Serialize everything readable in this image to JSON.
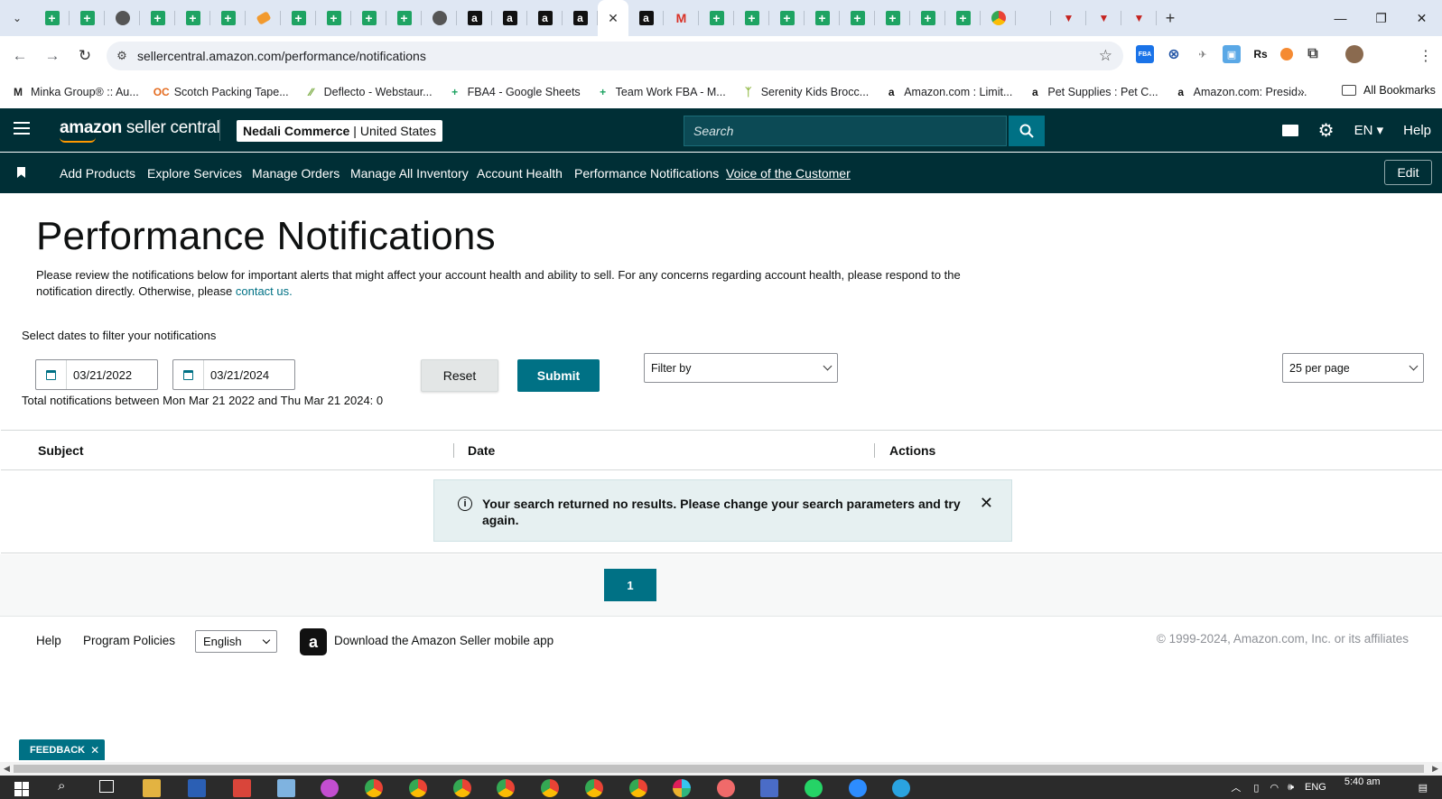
{
  "browser": {
    "tabs": [
      {
        "icon": "sheets-icon",
        "kind": "sheet"
      },
      {
        "icon": "sheets-icon",
        "kind": "sheet"
      },
      {
        "icon": "globe-icon",
        "kind": "circle"
      },
      {
        "icon": "sheets-icon",
        "kind": "sheet"
      },
      {
        "icon": "sheets-icon",
        "kind": "sheet"
      },
      {
        "icon": "sheets-icon",
        "kind": "sheet"
      },
      {
        "icon": "pen-icon",
        "kind": "pen"
      },
      {
        "icon": "sheets-icon",
        "kind": "sheet"
      },
      {
        "icon": "sheets-icon",
        "kind": "sheet"
      },
      {
        "icon": "sheets-icon",
        "kind": "sheet"
      },
      {
        "icon": "sheets-icon",
        "kind": "sheet"
      },
      {
        "icon": "cube-icon",
        "kind": "circle"
      },
      {
        "icon": "amazon-icon",
        "kind": "amz"
      },
      {
        "icon": "amazon-icon",
        "kind": "amz"
      },
      {
        "icon": "amazon-icon",
        "kind": "amz"
      },
      {
        "icon": "amazon-icon",
        "kind": "amz"
      },
      {
        "icon": "close-icon",
        "kind": "active"
      },
      {
        "icon": "amazon-icon",
        "kind": "amz"
      },
      {
        "icon": "gmail-icon",
        "kind": "gmail"
      },
      {
        "icon": "sheets-icon",
        "kind": "sheet"
      },
      {
        "icon": "sheets-icon",
        "kind": "sheet"
      },
      {
        "icon": "sheets-icon",
        "kind": "sheet"
      },
      {
        "icon": "sheets-icon",
        "kind": "sheet"
      },
      {
        "icon": "sheets-icon",
        "kind": "sheet"
      },
      {
        "icon": "sheets-icon",
        "kind": "sheet"
      },
      {
        "icon": "sheets-icon",
        "kind": "sheet"
      },
      {
        "icon": "sheets-icon",
        "kind": "sheet"
      },
      {
        "icon": "chrome-icon",
        "kind": "gcircle"
      },
      {
        "icon": "blank-icon",
        "kind": "blank"
      },
      {
        "icon": "triangle-icon",
        "kind": "tri"
      },
      {
        "icon": "triangle-icon",
        "kind": "tri"
      },
      {
        "icon": "triangle-icon",
        "kind": "tri"
      }
    ],
    "url": "sellercentral.amazon.com/performance/notifications",
    "bookmarks": [
      {
        "label": "Minka Group® :: Au...",
        "icon": "M",
        "color": "#222"
      },
      {
        "label": "Scotch Packing Tape...",
        "icon": "OC",
        "color": "#e46b1f"
      },
      {
        "label": "Deflecto - Webstaur...",
        "icon": "∕∕",
        "color": "#6aa12c"
      },
      {
        "label": "FBA4 - Google Sheets",
        "icon": "+",
        "color": "#1ea362"
      },
      {
        "label": "Team Work FBA - M...",
        "icon": "+",
        "color": "#1ea362"
      },
      {
        "label": "Serenity Kids Brocc...",
        "icon": "ᛉ",
        "color": "#8bb53b"
      },
      {
        "label": "Amazon.com : Limit...",
        "icon": "a",
        "color": "#111"
      },
      {
        "label": "Pet Supplies : Pet C...",
        "icon": "a",
        "color": "#111"
      },
      {
        "label": "Amazon.com: Presid...",
        "icon": "a",
        "color": "#111"
      }
    ],
    "all_bookmarks": "All Bookmarks"
  },
  "header": {
    "logo_bold": "amazon",
    "logo_rest": " seller central",
    "merchant": "Nedali Commerce",
    "marketplace": "United States",
    "search_placeholder": "Search",
    "language": "EN",
    "help": "Help"
  },
  "nav": {
    "items": [
      "Add Products",
      "Explore Services",
      "Manage Orders",
      "Manage All Inventory",
      "Account Health",
      "Performance Notifications"
    ],
    "link": "Voice of the Customer",
    "edit": "Edit"
  },
  "main": {
    "title": "Performance Notifications",
    "description": "Please review the notifications below for important alerts that might affect your account health and ability to sell. For any concerns regarding account health, please respond to the notification directly. Otherwise, please ",
    "contact_link": "contact us.",
    "filter_label": "Select dates to filter your notifications",
    "start_date": "03/21/2022",
    "end_date": "03/21/2024",
    "reset": "Reset",
    "submit": "Submit",
    "filter_by": "Filter by",
    "per_page": "25 per page",
    "total": "Total notifications between Mon Mar 21 2022 and Thu Mar 21 2024: 0",
    "columns": [
      "Subject",
      "Date",
      "Actions"
    ],
    "alert": "Your search returned no results. Please change your search parameters and try again.",
    "page": "1"
  },
  "footer": {
    "help": "Help",
    "policies": "Program Policies",
    "language": "English",
    "app_text": "Download the Amazon Seller mobile app",
    "copyright": "© 1999-2024, Amazon.com, Inc. or its affiliates"
  },
  "feedback": "FEEDBACK",
  "taskbar": {
    "lang": "ENG",
    "time": "5:40 am"
  }
}
